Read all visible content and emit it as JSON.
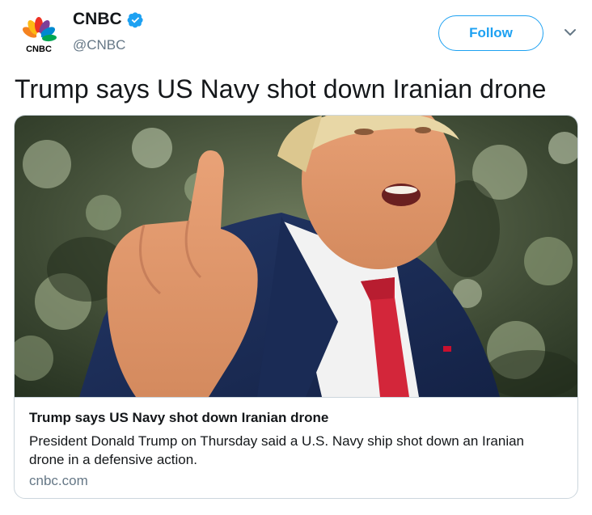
{
  "author": {
    "display_name": "CNBC",
    "handle": "@CNBC",
    "verified": true,
    "avatar_logo_text": "CNBC",
    "avatar_icon": "cnbc-peacock-logo"
  },
  "follow_button": {
    "label": "Follow",
    "color": "#1da1f2"
  },
  "menu_icon": "chevron-down-icon",
  "tweet": {
    "text": "Trump says US Navy shot down Iranian drone"
  },
  "card": {
    "image_icon": "photo-president-pointing",
    "title": "Trump says US Navy shot down Iranian drone",
    "description": "President Donald Trump on Thursday said a U.S. Navy ship shot down an Iranian drone in a defensive action.",
    "domain": "cnbc.com"
  },
  "colors": {
    "text": "#14171a",
    "secondary": "#657786",
    "border": "#ccd6dd",
    "accent": "#1da1f2"
  }
}
